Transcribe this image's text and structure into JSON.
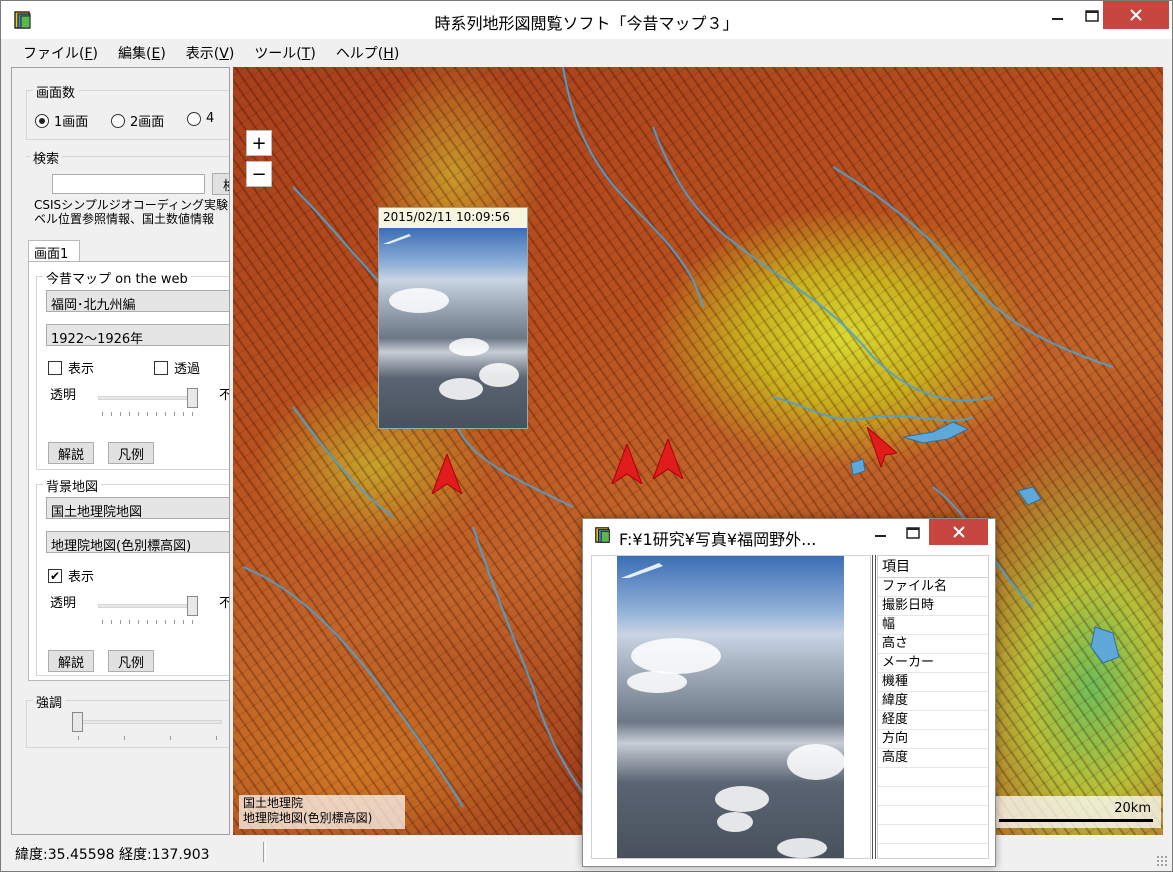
{
  "window": {
    "title": "時系列地形図閲覧ソフト「今昔マップ３」"
  },
  "menu": [
    {
      "label": "ファイル(",
      "key": "F",
      "close": ")"
    },
    {
      "label": "編集(",
      "key": "E",
      "close": ")"
    },
    {
      "label": "表示(",
      "key": "V",
      "close": ")"
    },
    {
      "label": "ツール(",
      "key": "T",
      "close": ")"
    },
    {
      "label": "ヘルプ(",
      "key": "H",
      "close": ")"
    }
  ],
  "panel": {
    "screens": {
      "legend": "画面数",
      "options": [
        "1画面",
        "2画面",
        "4"
      ],
      "selected": "1画面"
    },
    "search": {
      "legend": "検索",
      "input_value": "",
      "button_label": "検",
      "note_line1": "CSISシンプルジオコーディング実験(",
      "note_line2": "ベル位置参照情報、国土数値情報"
    },
    "tab": {
      "label": "画面1"
    },
    "konjaku": {
      "legend": "今昔マップ on the web",
      "region": "福岡･北九州編",
      "period": "1922～1926年",
      "show_label": "表示",
      "show_checked": false,
      "transparent_label": "透過",
      "transparent_checked": false,
      "slider_left": "透明",
      "slider_right": "不",
      "slider_level": 1.0,
      "btn_explain": "解説",
      "btn_legend": "凡例"
    },
    "background": {
      "legend": "背景地図",
      "source": "国土地理院地図",
      "layer": "地理院地図(色別標高図)",
      "show_label": "表示",
      "show_checked": true,
      "check_mark": "✔",
      "slider_left": "透明",
      "slider_right": "不",
      "slider_level": 1.0,
      "btn_explain": "解説",
      "btn_legend": "凡例"
    },
    "emphasis": {
      "legend": "強調",
      "slider_level": 0.0
    }
  },
  "map": {
    "zoom_in": "+",
    "zoom_out": "−",
    "photo_timestamp": "2015/02/11  10:09:56",
    "attribution_line1": "国土地理院",
    "attribution_line2": "地理院地図(色別標高図)",
    "scale_label": "20km"
  },
  "status": {
    "coords": "緯度:35.45598 経度:137.903"
  },
  "viewer": {
    "title": "F:¥1研究¥写真¥福岡野外...",
    "props_header": "項目",
    "props": [
      "ファイル名",
      "撮影日時",
      "幅",
      "高さ",
      "メーカー",
      "機種",
      "緯度",
      "経度",
      "方向",
      "高度",
      "",
      "",
      "",
      ""
    ]
  },
  "colors": {
    "close_red": "#c7463f",
    "marker_red": "#e01c1c"
  }
}
